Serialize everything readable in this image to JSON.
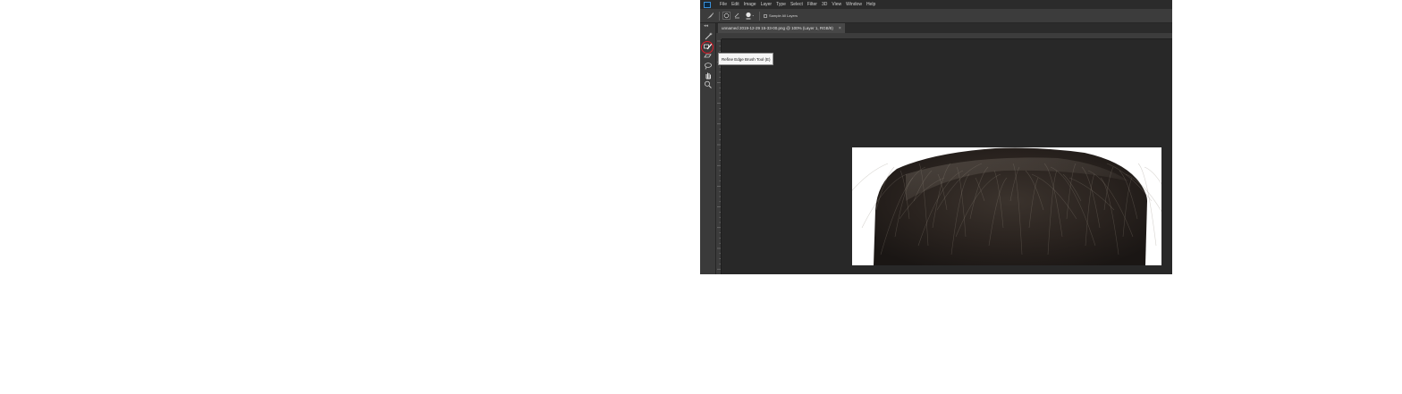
{
  "menubar": {
    "items": [
      "File",
      "Edit",
      "Image",
      "Layer",
      "Type",
      "Select",
      "Filter",
      "3D",
      "View",
      "Window",
      "Help"
    ]
  },
  "options": {
    "sample_all_label": "Sample All Layers",
    "icons": [
      "refine-radius-tool-icon",
      "brush-preset-icon",
      "brush-size-icon"
    ]
  },
  "document": {
    "tab_title": "unnamed 2019-12-29 15-33-00.png @ 100% (Layer 1, RGB/8)",
    "close_glyph": "×"
  },
  "tools": [
    "quick-selection-icon",
    "refine-radius-icon",
    "erase-refinements-icon",
    "lasso-icon",
    "hand-icon",
    "zoom-icon"
  ],
  "tooltip": {
    "text": "Refine Edge Brush Tool (E)"
  },
  "colors": {
    "highlight": "#e01b2a",
    "canvas_bg": "#282828",
    "panel_bg": "#535353"
  }
}
